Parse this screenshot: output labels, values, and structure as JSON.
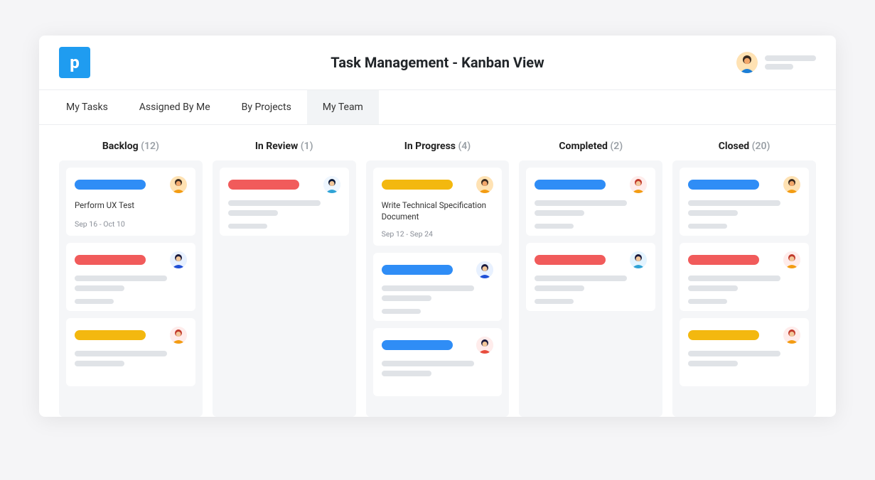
{
  "header": {
    "logo_letter": "p",
    "title": "Task Management - Kanban View"
  },
  "tabs": [
    {
      "label": "My Tasks",
      "active": false
    },
    {
      "label": "Assigned By Me",
      "active": false
    },
    {
      "label": "By Projects",
      "active": false
    },
    {
      "label": "My Team",
      "active": true
    }
  ],
  "colors": {
    "blue": "#2f8df6",
    "red": "#f15b5b",
    "amber": "#f3b80f"
  },
  "columns": [
    {
      "name": "Backlog",
      "count": "(12)",
      "cards": [
        {
          "pill": "blue",
          "avatar": "a1",
          "title": "Perform UX Test",
          "date": "Sep 16 - Oct 10"
        },
        {
          "pill": "red",
          "avatar": "a2",
          "placeholder": true,
          "show_date_ph": true
        },
        {
          "pill": "amber",
          "avatar": "a3",
          "placeholder": true
        }
      ]
    },
    {
      "name": "In Review",
      "count": "(1)",
      "cards": [
        {
          "pill": "red",
          "avatar": "a4",
          "placeholder": true,
          "show_date_ph": true
        }
      ]
    },
    {
      "name": "In Progress",
      "count": "(4)",
      "cards": [
        {
          "pill": "amber",
          "avatar": "a1",
          "title": "Write Technical Specification Document",
          "date": "Sep 12 - Sep 24"
        },
        {
          "pill": "blue",
          "avatar": "a2",
          "placeholder": true,
          "show_date_ph": true
        },
        {
          "pill": "blue",
          "avatar": "a5",
          "placeholder": true
        }
      ]
    },
    {
      "name": "Completed",
      "count": "(2)",
      "cards": [
        {
          "pill": "blue",
          "avatar": "a3",
          "placeholder": true,
          "show_date_ph": true
        },
        {
          "pill": "red",
          "avatar": "a6",
          "placeholder": true,
          "show_date_ph": true
        }
      ]
    },
    {
      "name": "Closed",
      "count": "(20)",
      "cards": [
        {
          "pill": "blue",
          "avatar": "a1",
          "placeholder": true,
          "show_date_ph": true
        },
        {
          "pill": "red",
          "avatar": "a7",
          "placeholder": true,
          "show_date_ph": true
        },
        {
          "pill": "amber",
          "avatar": "a3",
          "placeholder": true
        }
      ]
    }
  ]
}
